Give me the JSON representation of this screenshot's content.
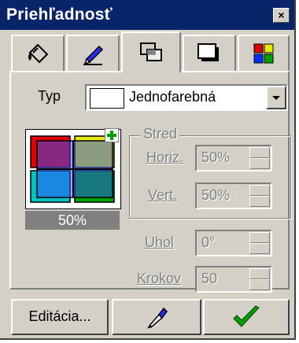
{
  "title": "Priehľadnosť",
  "close_symbol": "×",
  "tabs": [
    {
      "icon": "paint-bucket-icon",
      "active": false
    },
    {
      "icon": "pen-icon",
      "active": false
    },
    {
      "icon": "transparency-icon",
      "active": true
    },
    {
      "icon": "shadow-icon",
      "active": false
    },
    {
      "icon": "color-grid-icon",
      "active": false
    }
  ],
  "type_label": "Typ",
  "type_value": "Jednofarebná",
  "preview_percent": "50%",
  "center_group": {
    "title": "Stred",
    "horiz_label": "Horiz.",
    "horiz_value": "50%",
    "vert_label": "Vert.",
    "vert_value": "50%"
  },
  "angle_label": "Uhol",
  "angle_value": "0°",
  "steps_label": "Krokov",
  "steps_value": "50",
  "buttons": {
    "edit_label": "Editácia...",
    "eyedropper_icon": "eyedropper-icon",
    "ok_icon": "check-icon"
  },
  "colors": {
    "titlebar": "#0a246a",
    "check": "#00a000",
    "red": "#e00000",
    "yellow": "#e8e800",
    "cyan": "#00c0c0",
    "green": "#00a000"
  }
}
